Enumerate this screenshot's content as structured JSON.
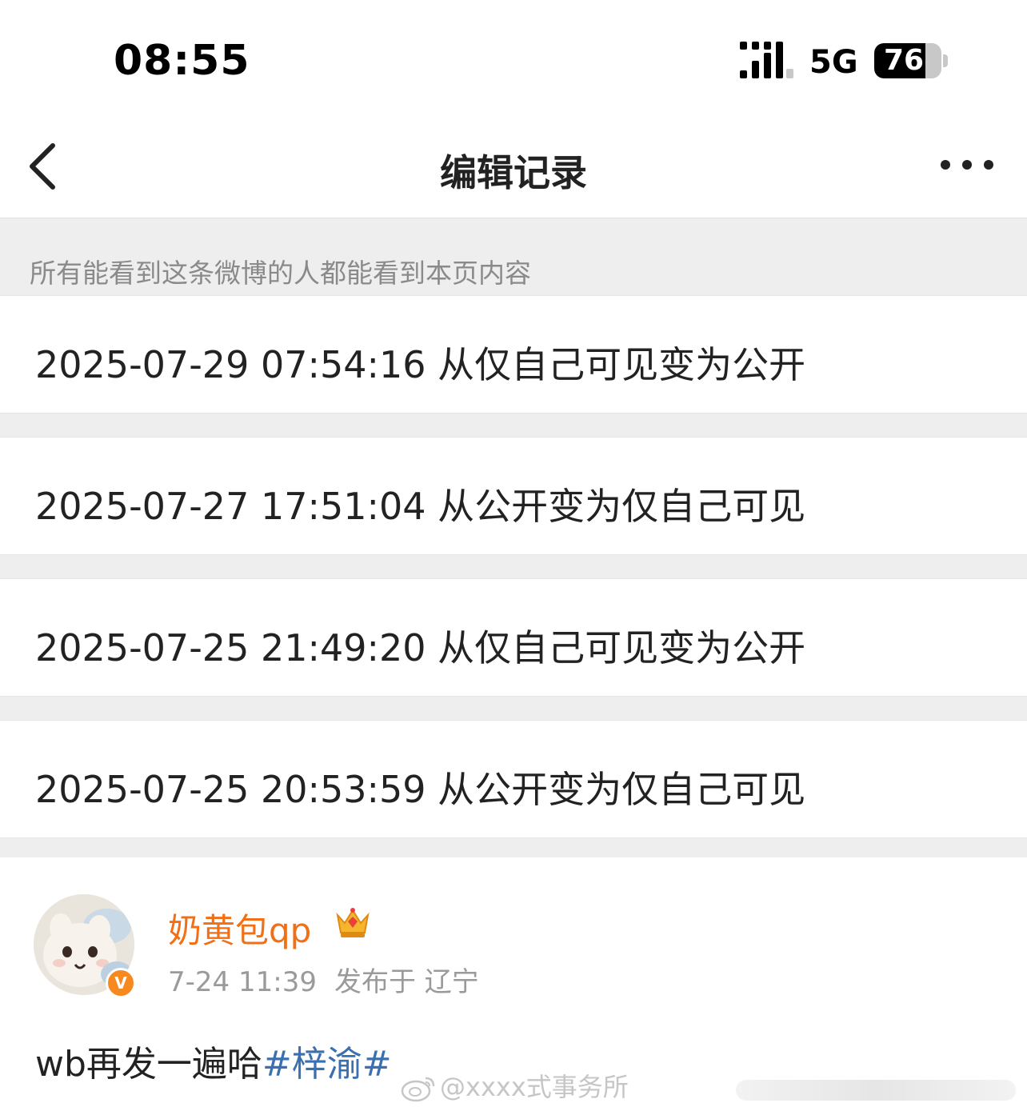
{
  "status_bar": {
    "time": "08:55",
    "network": "5G",
    "battery_level": "76",
    "battery_fraction": 0.76
  },
  "nav": {
    "title": "编辑记录"
  },
  "notice": "所有能看到这条微博的人都能看到本页内容",
  "records": [
    {
      "text": "2025-07-29 07:54:16 从仅自己可见变为公开"
    },
    {
      "text": "2025-07-27 17:51:04 从公开变为仅自己可见"
    },
    {
      "text": "2025-07-25 21:49:20 从仅自己可见变为公开"
    },
    {
      "text": "2025-07-25 20:53:59 从公开变为仅自己可见"
    }
  ],
  "post": {
    "username": "奶黄包qp",
    "verified_mark": "V",
    "time": "7-24 11:39",
    "location": "发布于 辽宁",
    "body_text": "wb再发一遍哈",
    "hashtag": "#梓渝#",
    "watermark": "@xxxx式事务所"
  },
  "colors": {
    "username": "#f26f16",
    "hashtag": "#3a6fb0",
    "verified_badge": "#f6891f",
    "gap_background": "#eeeeee"
  },
  "icons": {
    "back": "chevron-left-icon",
    "more": "more-horizontal-icon",
    "crown": "crown-icon",
    "watermark": "weibo-logo-icon"
  }
}
